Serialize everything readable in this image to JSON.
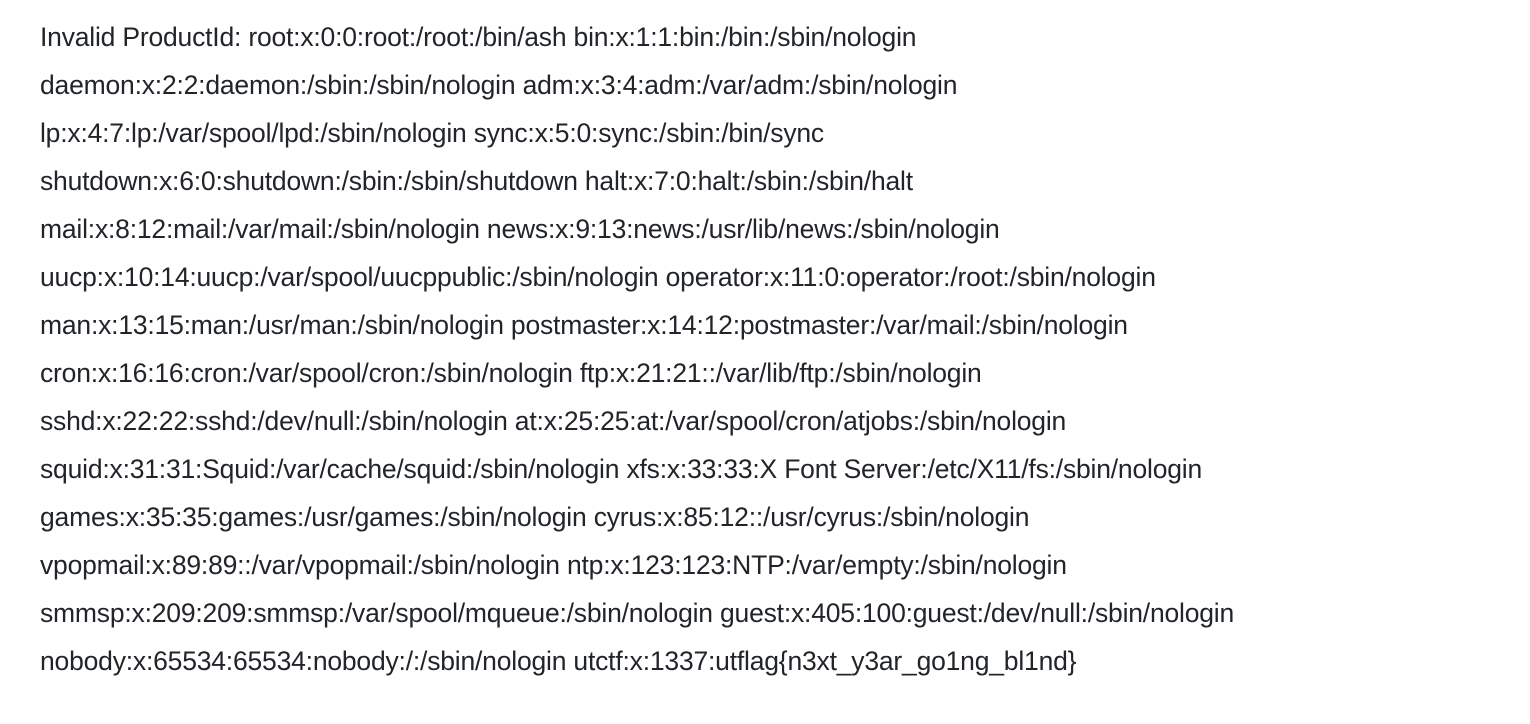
{
  "response": {
    "lines": [
      "Invalid ProductId: root:x:0:0:root:/root:/bin/ash bin:x:1:1:bin:/bin:/sbin/nologin",
      "daemon:x:2:2:daemon:/sbin:/sbin/nologin adm:x:3:4:adm:/var/adm:/sbin/nologin",
      "lp:x:4:7:lp:/var/spool/lpd:/sbin/nologin sync:x:5:0:sync:/sbin:/bin/sync",
      "shutdown:x:6:0:shutdown:/sbin:/sbin/shutdown halt:x:7:0:halt:/sbin:/sbin/halt",
      "mail:x:8:12:mail:/var/mail:/sbin/nologin news:x:9:13:news:/usr/lib/news:/sbin/nologin",
      "uucp:x:10:14:uucp:/var/spool/uucppublic:/sbin/nologin operator:x:11:0:operator:/root:/sbin/nologin",
      "man:x:13:15:man:/usr/man:/sbin/nologin postmaster:x:14:12:postmaster:/var/mail:/sbin/nologin",
      "cron:x:16:16:cron:/var/spool/cron:/sbin/nologin ftp:x:21:21::/var/lib/ftp:/sbin/nologin",
      "sshd:x:22:22:sshd:/dev/null:/sbin/nologin at:x:25:25:at:/var/spool/cron/atjobs:/sbin/nologin",
      "squid:x:31:31:Squid:/var/cache/squid:/sbin/nologin xfs:x:33:33:X Font Server:/etc/X11/fs:/sbin/nologin",
      "games:x:35:35:games:/usr/games:/sbin/nologin cyrus:x:85:12::/usr/cyrus:/sbin/nologin",
      "vpopmail:x:89:89::/var/vpopmail:/sbin/nologin ntp:x:123:123:NTP:/var/empty:/sbin/nologin",
      "smmsp:x:209:209:smmsp:/var/spool/mqueue:/sbin/nologin guest:x:405:100:guest:/dev/null:/sbin/nologin",
      "nobody:x:65534:65534:nobody:/:/sbin/nologin utctf:x:1337:utflag{n3xt_y3ar_go1ng_bl1nd}"
    ]
  }
}
